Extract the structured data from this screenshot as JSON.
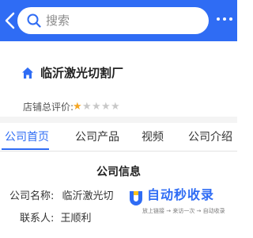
{
  "search": {
    "placeholder": "搜索"
  },
  "shop": {
    "name": "临沂激光切割厂",
    "rating_label": "店铺总评价:",
    "rating_value": 1,
    "rating_max": 5
  },
  "tabs": [
    {
      "label": "公司首页",
      "active": true
    },
    {
      "label": "公司产品",
      "active": false
    },
    {
      "label": "视频",
      "active": false
    },
    {
      "label": "公司介绍",
      "active": false
    }
  ],
  "company_info": {
    "title": "公司信息",
    "name_label": "公司名称:",
    "name_value": "临沂激光切",
    "contact_label": "联系人:",
    "contact_value": "王顺利"
  },
  "watermark": {
    "title": "自动秒收录",
    "subtitle": "放上链接 → 来访一次 → 自动收录"
  },
  "colors": {
    "accent": "#2f6cf4",
    "star": "#f5a623"
  }
}
